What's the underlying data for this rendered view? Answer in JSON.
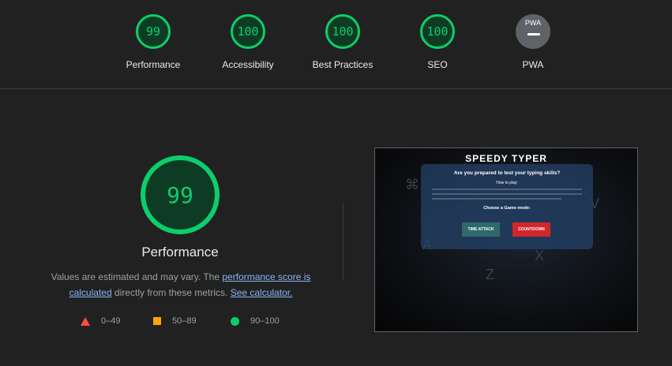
{
  "scores": [
    {
      "value": "99",
      "label": "Performance"
    },
    {
      "value": "100",
      "label": "Accessibility"
    },
    {
      "value": "100",
      "label": "Best Practices"
    },
    {
      "value": "100",
      "label": "SEO"
    },
    {
      "badge": "PWA",
      "label": "PWA"
    }
  ],
  "main": {
    "score": "99",
    "title": "Performance",
    "desc_prefix": "Values are estimated and may vary. The ",
    "link_score": "performance score is calculated",
    "desc_mid": " directly from these metrics. ",
    "link_calc": "See calculator."
  },
  "legend": {
    "fail": "0–49",
    "average": "50–89",
    "pass": "90–100"
  },
  "screenshot": {
    "title": "SPEEDY TYPER",
    "question": "Are you prepared to test your typing skills?",
    "how_to": "How to play:",
    "mode_heading": "Choose a Game mode:",
    "btn_time_attack": "TIME ATTACK",
    "btn_countdown": "COUNTDOWN"
  },
  "colors": {
    "pass": "#0cce6b",
    "average": "#ffa400",
    "fail": "#ff4e42",
    "link": "#8ab4f8"
  }
}
